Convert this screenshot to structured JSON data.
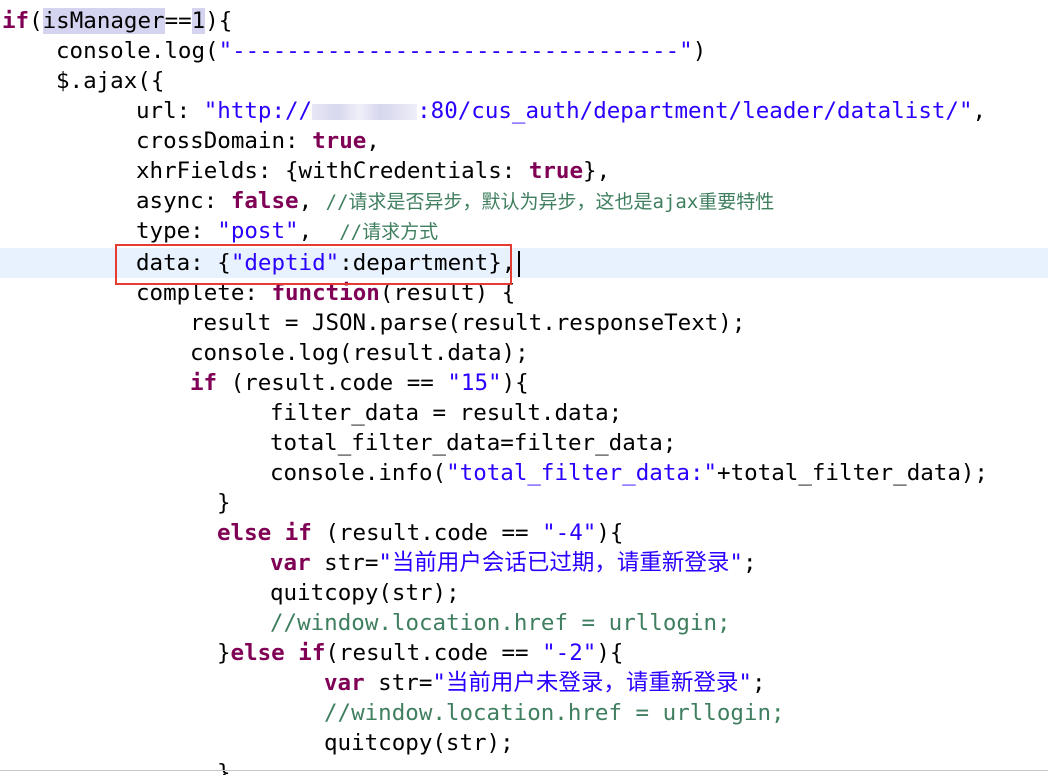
{
  "code": {
    "l01": {
      "kw1": "if",
      "p1": "(",
      "var": "isManager",
      "op": "==",
      "num": "1",
      "p2": "){"
    },
    "l02": {
      "a": "console.log(",
      "s": "\"---------------------------------\"",
      "b": ")"
    },
    "l03": {
      "a": "$.ajax({"
    },
    "l04": {
      "a": "url: ",
      "s1": "\"http://",
      "s2": ":80/cus_auth/department/leader/datalist/\"",
      "b": ","
    },
    "l05": {
      "a": "crossDomain: ",
      "kw": "true",
      "b": ","
    },
    "l06": {
      "a": "xhrFields: {withCredentials: ",
      "kw": "true",
      "b": "},"
    },
    "l07": {
      "a": "async: ",
      "kw": "false",
      "b": ", ",
      "c": "//请求是否异步，默认为异步，这也是ajax重要特性"
    },
    "l08": {
      "a": "type: ",
      "s": "\"post\"",
      "b": ",  ",
      "c": "//请求方式"
    },
    "l09": {
      "a": "data: {",
      "s": "\"deptid\"",
      "b": ":department},"
    },
    "l10": {
      "a": "complete: ",
      "kw": "function",
      "b": "(result) {"
    },
    "l11": {
      "a": "result = JSON.parse(result.responseText);"
    },
    "l12": {
      "a": "console.log(result.data);"
    },
    "l13": {
      "kw": "if",
      "a": " (result.code == ",
      "s": "\"15\"",
      "b": "){"
    },
    "l14": {
      "a": "filter_data = result.data;"
    },
    "l15": {
      "a": "total_filter_data=filter_data;"
    },
    "l16": {
      "a": "console.info(",
      "s": "\"total_filter_data:\"",
      "b": "+total_filter_data);"
    },
    "l17": {
      "a": "}"
    },
    "l18": {
      "kw1": "else",
      "sp": " ",
      "kw2": "if",
      "a": " (result.code == ",
      "s": "\"-4\"",
      "b": "){"
    },
    "l19": {
      "kw": "var",
      "a": " str=",
      "s": "\"当前用户会话已过期，请重新登录\"",
      "b": ";"
    },
    "l20": {
      "a": "quitcopy(str);"
    },
    "l21": {
      "c": "//window.location.href = urllogin;"
    },
    "l22": {
      "a": "}",
      "kw1": "else",
      "sp": " ",
      "kw2": "if",
      "b": "(result.code == ",
      "s": "\"-2\"",
      "e": "){"
    },
    "l23": {
      "kw": "var",
      "a": " str=",
      "s": "\"当前用户未登录，请重新登录\"",
      "b": ";"
    },
    "l24": {
      "c": "//window.location.href = urllogin;"
    },
    "l25": {
      "a": "quitcopy(str);"
    },
    "l26": {
      "a": "}"
    }
  },
  "colors": {
    "keyword": "#7f0055",
    "string": "#2a00ff",
    "comment": "#3f7f5f",
    "active_line": "#e8f2fe",
    "highlight_box": "#e53b32",
    "occurrence_highlight": "#d4d4f0"
  }
}
